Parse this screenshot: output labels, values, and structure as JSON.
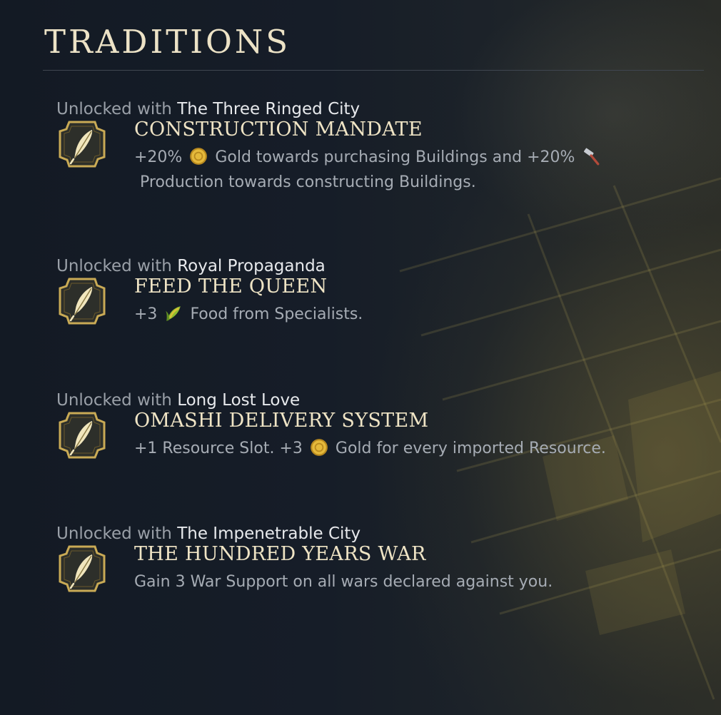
{
  "panel": {
    "title": "TRADITIONS"
  },
  "labels": {
    "unlocked_with": "Unlocked with"
  },
  "colors": {
    "title": "#ece2c6",
    "tradition_name": "#efe4c5",
    "description": "#a6acb4",
    "unlock_source": "#e7e9ec",
    "badge_gold": "#c9aa55"
  },
  "traditions": [
    {
      "unlock_source": "The Three Ringed City",
      "name": "CONSTRUCTION MANDATE",
      "icon": "quill-icon",
      "desc": {
        "a": "+20%",
        "gold_icon": "gold-coin-icon",
        "b": "Gold towards purchasing Buildings and +20%",
        "production_icon": "hammer-icon",
        "c": "Production towards constructing Buildings."
      }
    },
    {
      "unlock_source": "Royal Propaganda",
      "name": "FEED THE QUEEN",
      "icon": "quill-icon",
      "desc": {
        "a": "+3",
        "food_icon": "corn-icon",
        "b": "Food from Specialists."
      }
    },
    {
      "unlock_source": "Long Lost Love",
      "name": "OMASHI DELIVERY SYSTEM",
      "icon": "quill-icon",
      "desc": {
        "a": "+1 Resource Slot. +3",
        "gold_icon": "gold-coin-icon",
        "b": "Gold for every imported Resource."
      }
    },
    {
      "unlock_source": "The Impenetrable City",
      "name": "THE HUNDRED YEARS WAR",
      "icon": "quill-icon",
      "desc": {
        "a": "Gain 3 War Support on all wars declared against you."
      }
    }
  ]
}
